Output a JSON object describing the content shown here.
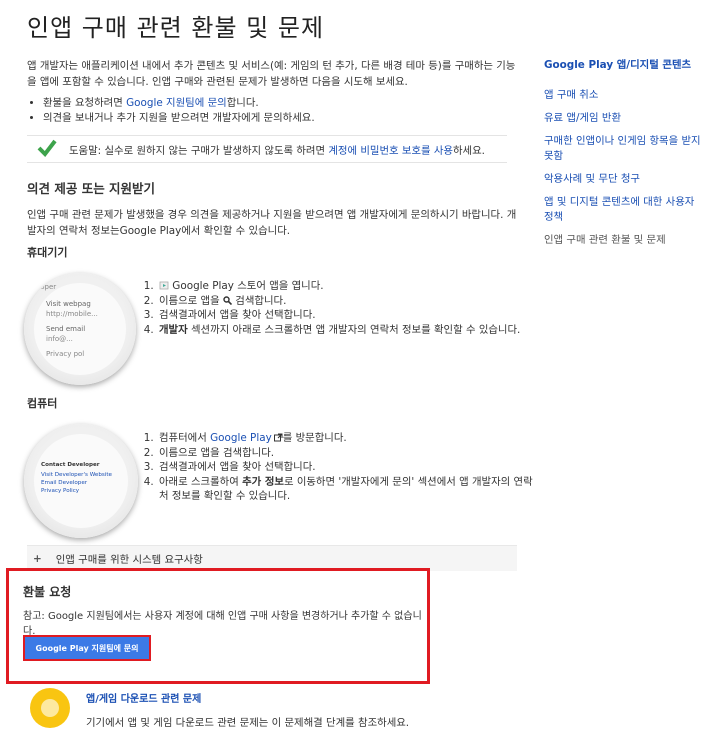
{
  "page": {
    "title": "인앱 구매 관련 환불 및 문제",
    "intro": "앱 개발자는 애플리케이션 내에서 추가 콘텐츠 및 서비스(예: 게임의 턴 추가, 다른 배경 테마 등)를 구매하는 기능을 앱에 포함할 수 있습니다. 인앱 구매와 관련된 문제가 발생하면 다음을 시도해 보세요.",
    "bullets": [
      {
        "pre": "환불을 요청하려면 ",
        "link": "Google 지원팀에 문의",
        "post": "합니다."
      },
      {
        "pre": "의견을 보내거나 추가 지원을 받으려면 개발자에게 문의하세요.",
        "link": "",
        "post": ""
      }
    ],
    "tip": {
      "pre": "도움말: 실수로 원하지 않는 구매가 발생하지 않도록 하려면 ",
      "link": "계정에 비밀번호 보호를 사용",
      "post": "하세요."
    },
    "feedback": {
      "heading": "의견 제공 또는 지원받기",
      "text": "인앱 구매 관련 문제가 발생했을 경우 의견을 제공하거나 지원을 받으려면 앱 개발자에게 문의하시기 바랍니다. 개발자의 연락처 정보는Google Play에서 확인할 수 있습니다."
    },
    "mobile": {
      "heading": "휴대기기",
      "steps": [
        {
          "pre": "",
          "link": "",
          "text": " Google Play 스토어 앱을 엽니다."
        },
        {
          "pre": "이름으로 앱을 ",
          "link": "",
          "text": " 검색합니다."
        },
        {
          "pre": "검색결과에서 앱을 찾아 선택합니다.",
          "link": "",
          "text": ""
        },
        {
          "pre": "",
          "bold": "개발자",
          "text": " 섹션까지 아래로 스크롤하면 앱 개발자의 연락처 정보를 확인할 수 있습니다."
        }
      ],
      "phone_lines": [
        "eloper",
        "Visit webpag",
        "http://mobile...",
        "Send email",
        "info@...",
        "Privacy pol"
      ]
    },
    "computer": {
      "heading": "컴퓨터",
      "steps": [
        {
          "pre": "컴퓨터에서 ",
          "link": "Google Play",
          "text": "를 방문합니다."
        },
        {
          "pre": "이름으로 앱을 검색합니다.",
          "link": "",
          "text": ""
        },
        {
          "pre": "검색결과에서 앱을 찾아 선택합니다.",
          "link": "",
          "text": ""
        },
        {
          "pre": "아래로 스크롤하여 ",
          "bold": "추가 정보",
          "text": "로 이동하면 '개발자에게 문의' 섹션에서 앱 개발자의 연락처 정보를 확인할 수 있습니다."
        }
      ],
      "contact": {
        "title": "Contact Developer",
        "links": [
          "Visit Developer's Website",
          "Email Developer",
          "Privacy Policy"
        ]
      }
    },
    "expander_label": "인앱 구매를 위한 시스템 요구사항",
    "refund": {
      "heading": "환불 요청",
      "note": "참고: Google 지원팀에서는 사용자 계정에 대해 인앱 구매 사항을 변경하거나 추가할 수 없습니다.",
      "button": "Google Play 지원팀에 문의"
    },
    "download": {
      "title": "앱/게임 다운로드 관련 문제",
      "text": "기기에서 앱 및 게임 다운로드 관련 문제는 이 문제해결 단계를 참조하세요."
    }
  },
  "sidebar": {
    "header": "Google Play 앱/디지털 콘텐츠",
    "items": [
      "앱 구매 취소",
      "유료 앱/게임 반환",
      "구매한 인앱이나 인게임 항목을 받지 못함",
      "악용사례 및 무단 청구",
      "앱 및 디지털 콘텐츠에 대한 사용자 정책"
    ],
    "current": "인앱 구매 관련 환불 및 문제"
  },
  "colors": {
    "link": "#1a4fb3",
    "button": "#3c7ae6",
    "highlight": "#e01b22",
    "check": "#3da34b"
  },
  "icons": [
    "check-icon",
    "play-store-icon",
    "search-icon",
    "external-link-icon",
    "plus-icon",
    "download-icon"
  ]
}
